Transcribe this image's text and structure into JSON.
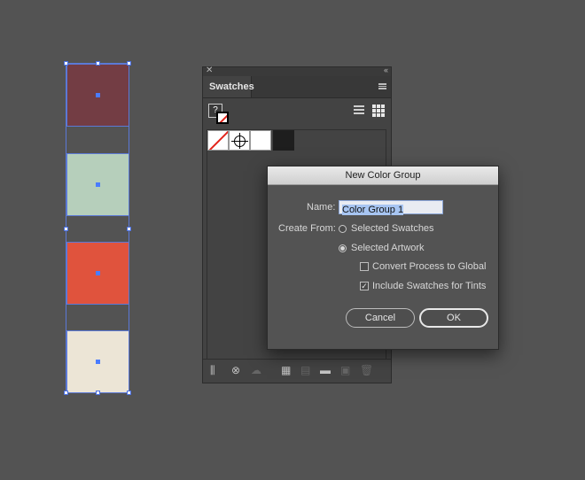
{
  "artboard": {
    "swatches": [
      {
        "name": "maroon",
        "color": "#733d44"
      },
      {
        "name": "sage",
        "color": "#b6cfbb"
      },
      {
        "name": "coral",
        "color": "#e0533d"
      },
      {
        "name": "cream",
        "color": "#ece5d6"
      }
    ],
    "selection_color": "#5b79d6"
  },
  "swatches_panel": {
    "tab_label": "Swatches",
    "fill_unknown_glyph": "?",
    "icons": [
      "close-icon",
      "collapse-icon",
      "panel-menu-icon",
      "list-view-icon",
      "grid-view-icon"
    ],
    "swatch_chips": [
      "none",
      "registration",
      "white",
      "black"
    ],
    "footer_icons": [
      {
        "name": "swatch-libraries-icon",
        "glyph": "⫼",
        "enabled": true
      },
      {
        "name": "show-kinds-icon",
        "glyph": "⊗",
        "enabled": true
      },
      {
        "name": "cloud-icon",
        "glyph": "☁",
        "enabled": false
      },
      {
        "name": "new-color-group-icon",
        "glyph": "▦",
        "enabled": true
      },
      {
        "name": "swatch-options-icon",
        "glyph": "▤",
        "enabled": false
      },
      {
        "name": "new-folder-icon",
        "glyph": "▬",
        "enabled": true
      },
      {
        "name": "new-swatch-icon",
        "glyph": "▣",
        "enabled": false
      },
      {
        "name": "delete-icon",
        "glyph": "🗑",
        "enabled": false
      }
    ]
  },
  "dialog": {
    "title": "New Color Group",
    "name_label": "Name:",
    "name_value": "Color Group 1",
    "create_from_label": "Create From:",
    "options": {
      "selected_swatches": "Selected Swatches",
      "selected_artwork": "Selected Artwork"
    },
    "selected_option": "selected_artwork",
    "checkboxes": {
      "convert_process": {
        "label": "Convert Process to Global",
        "checked": false
      },
      "include_tints": {
        "label": "Include Swatches for Tints",
        "checked": true
      }
    },
    "cancel_label": "Cancel",
    "ok_label": "OK"
  }
}
